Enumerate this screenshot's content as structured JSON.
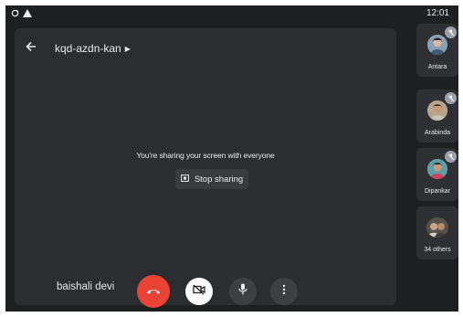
{
  "status_bar": {
    "time": "12:01",
    "icons": [
      "sync-icon",
      "warning-icon"
    ]
  },
  "meeting": {
    "code": "kqd-azdn-kan",
    "share_message": "You're sharing your screen with everyone",
    "stop_sharing_label": "Stop sharing",
    "self_name": "baishali devi"
  },
  "controls": [
    {
      "name": "end-call-button",
      "icon": "phone-hangup-icon",
      "color": "#ea4335"
    },
    {
      "name": "camera-toggle-button",
      "icon": "camera-off-icon",
      "color": "#ffffff"
    },
    {
      "name": "microphone-button",
      "icon": "microphone-icon",
      "color": "#3c4043"
    },
    {
      "name": "more-options-button",
      "icon": "more-vert-icon",
      "color": "#3c4043"
    }
  ],
  "participants": [
    {
      "name": "Antara",
      "muted": true
    },
    {
      "name": "Arabinda",
      "muted": true
    },
    {
      "name": "Dipankar",
      "muted": true
    },
    {
      "name": "34 others",
      "muted": false
    }
  ],
  "colors": {
    "background": "#1e1f21",
    "stage": "#2c2d30",
    "tile": "#2f3033",
    "end_call": "#ea4335"
  }
}
